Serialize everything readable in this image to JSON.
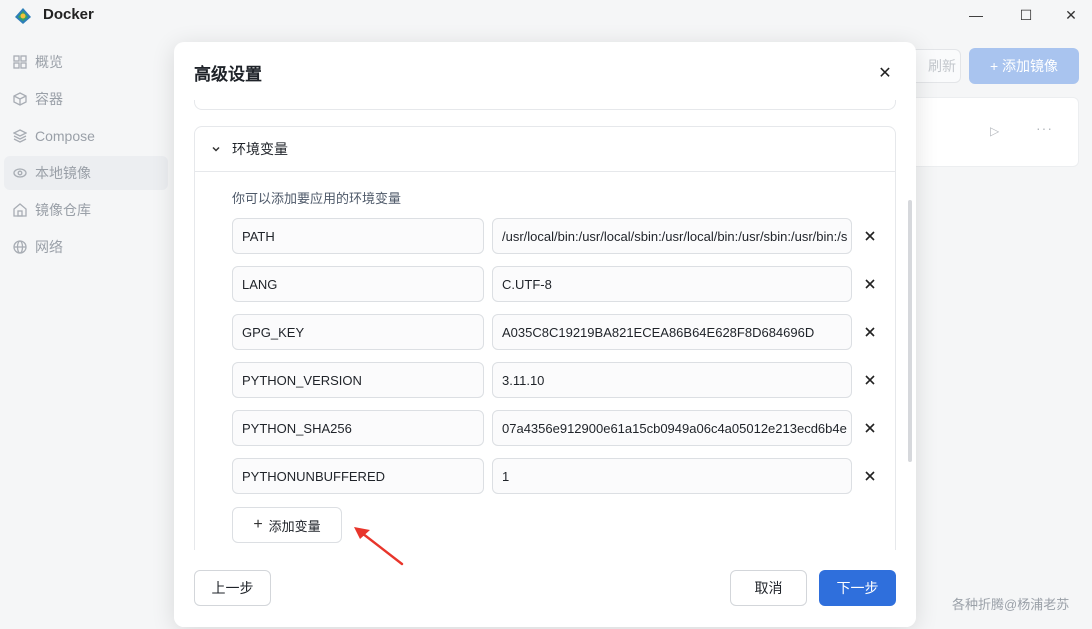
{
  "window": {
    "title": "Docker",
    "minimize_glyph": "—",
    "maximize_glyph": "☐",
    "close_glyph": "✕"
  },
  "sidebar": {
    "items": [
      {
        "label": "概览",
        "icon": "grid-icon",
        "active": false
      },
      {
        "label": "容器",
        "icon": "cube-icon",
        "active": false
      },
      {
        "label": "Compose",
        "icon": "layers-icon",
        "active": false
      },
      {
        "label": "本地镜像",
        "icon": "disc-icon",
        "active": true
      },
      {
        "label": "镜像仓库",
        "icon": "home-icon",
        "active": false
      },
      {
        "label": "网络",
        "icon": "globe-icon",
        "active": false
      }
    ]
  },
  "main": {
    "refresh_label": "刷新",
    "add_image_label": "+ 添加镜像"
  },
  "watermark": "各种折腾@杨浦老苏",
  "modal": {
    "title": "高级设置",
    "close_glyph": "✕",
    "env_section": {
      "title": "环境变量",
      "description": "你可以添加要应用的环境变量",
      "rows": [
        {
          "key": "PATH",
          "value": "/usr/local/bin:/usr/local/sbin:/usr/local/bin:/usr/sbin:/usr/bin:/s"
        },
        {
          "key": "LANG",
          "value": "C.UTF-8"
        },
        {
          "key": "GPG_KEY",
          "value": "A035C8C19219BA821ECEA86B64E628F8D684696D"
        },
        {
          "key": "PYTHON_VERSION",
          "value": "3.11.10"
        },
        {
          "key": "PYTHON_SHA256",
          "value": "07a4356e912900e61a15cb0949a06c4a05012e213ecd6b4e"
        },
        {
          "key": "PYTHONUNBUFFERED",
          "value": "1"
        }
      ],
      "add_var_label": "添加变量"
    },
    "footer": {
      "prev_label": "上一步",
      "cancel_label": "取消",
      "next_label": "下一步"
    }
  },
  "colors": {
    "primary": "#2f6fdc",
    "annotation_arrow": "#e8352b"
  }
}
